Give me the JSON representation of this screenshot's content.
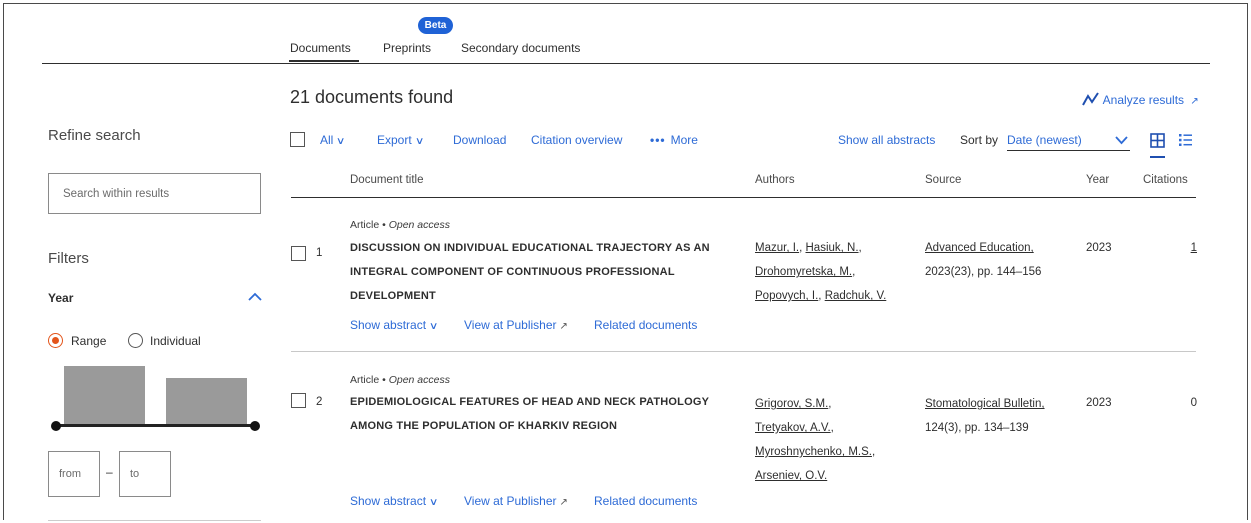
{
  "tabs": {
    "documents": "Documents",
    "preprints": "Preprints",
    "secondary": "Secondary documents",
    "beta_badge": "Beta"
  },
  "sidebar": {
    "refine_title": "Refine search",
    "search_placeholder": "Search within results",
    "filters_title": "Filters",
    "year_label": "Year",
    "range_label": "Range",
    "individual_label": "Individual",
    "from_placeholder": "from",
    "to_placeholder": "to",
    "dash": "–"
  },
  "results": {
    "count_text": "21 documents found",
    "analyze": "Analyze results",
    "toolbar": {
      "all": "All",
      "export": "Export",
      "download": "Download",
      "citation_overview": "Citation overview",
      "more": "More",
      "show_all_abstracts": "Show all abstracts",
      "sort_by": "Sort by",
      "sort_value": "Date (newest)"
    },
    "columns": {
      "title": "Document title",
      "authors": "Authors",
      "source": "Source",
      "year": "Year",
      "citations": "Citations"
    },
    "rows": [
      {
        "num": "1",
        "type": "Article",
        "access": "Open access",
        "title": "DISCUSSION ON INDIVIDUAL EDUCATIONAL TRAJECTORY AS AN INTEGRAL COMPONENT OF CONTINUOUS PROFESSIONAL DEVELOPMENT",
        "authors": [
          "Mazur, I.",
          "Hasiuk, N.",
          "Drohomyretska, M.",
          "Popovych, I.",
          "Radchuk, V."
        ],
        "source_name": "Advanced Education,",
        "source_detail": "2023(23), pp. 144–156",
        "year": "2023",
        "citations": "1",
        "show_abstract": "Show abstract",
        "view_publisher": "View at Publisher",
        "related": "Related documents"
      },
      {
        "num": "2",
        "type": "Article",
        "access": "Open access",
        "title": "EPIDEMIOLOGICAL FEATURES OF HEAD AND NECK PATHOLOGY AMONG THE POPULATION OF KHARKIV REGION",
        "authors": [
          "Grigorov, S.M.",
          "Tretyakov, A.V.",
          "Myroshnychenko, M.S.",
          "Arseniev, O.V."
        ],
        "source_name": "Stomatological Bulletin,",
        "source_detail": "124(3), pp. 134–139",
        "year": "2023",
        "citations": "0",
        "show_abstract": "Show abstract",
        "view_publisher": "View at Publisher",
        "related": "Related documents"
      }
    ]
  },
  "colors": {
    "link": "#2e6bd6",
    "accent_orange": "#e3541a",
    "beta_blue": "#1f62d6"
  }
}
